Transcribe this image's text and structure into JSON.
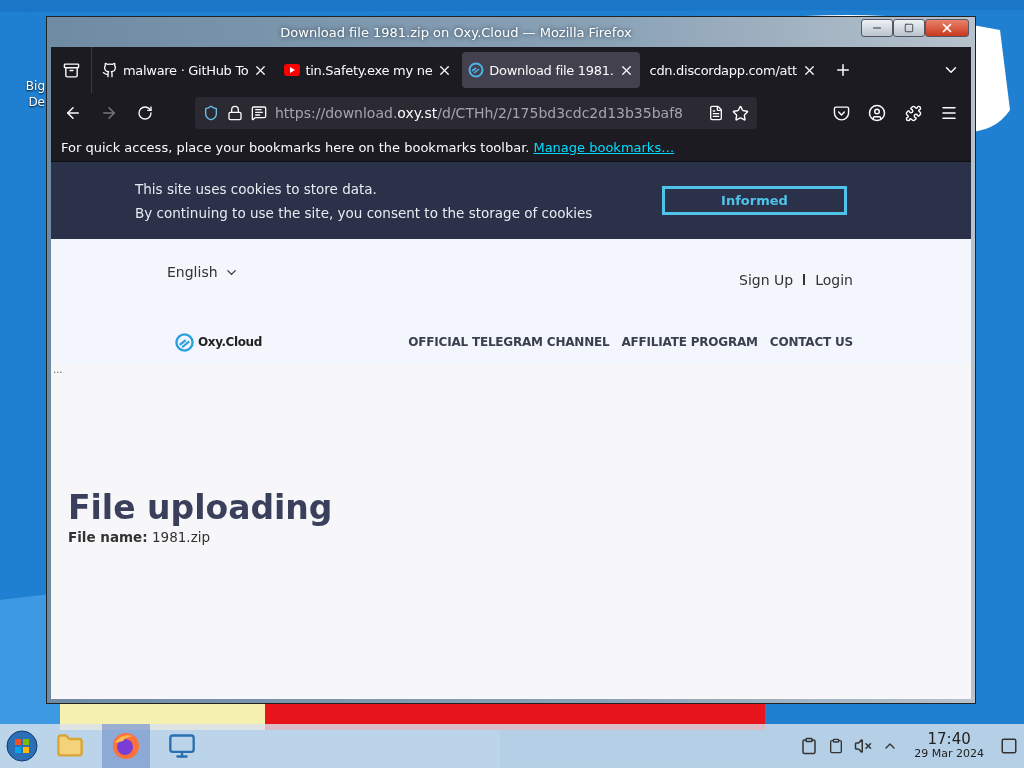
{
  "desktop": {
    "icons": [
      {
        "label_lines": [
          "Big",
          "De"
        ]
      }
    ]
  },
  "window": {
    "title": "Download file 1981.zip on Oxy.Cloud — Mozilla Firefox"
  },
  "tabs": [
    {
      "label": "malware · GitHub To",
      "kind": "github",
      "selected": false
    },
    {
      "label": "tin.Safety.exe my ne",
      "kind": "youtube",
      "selected": false
    },
    {
      "label": "Download file 1981.",
      "kind": "oxy",
      "selected": true
    },
    {
      "label": "cdn.discordapp.com/att",
      "kind": "plain",
      "selected": false
    }
  ],
  "url": {
    "prefix": "https://download.",
    "domain": "oxy.st",
    "path": "/d/CTHh/2/175bd3cdc2d13b35baf8"
  },
  "bookmarks_bar": {
    "message": "For quick access, place your bookmarks here on the bookmarks toolbar.",
    "link": "Manage bookmarks…"
  },
  "cookie_banner": {
    "lines": [
      "This site uses cookies to store data.",
      "By continuing to use the site, you consent to the storage of cookies"
    ],
    "button": "Informed"
  },
  "site_header": {
    "language": "English",
    "auth": [
      "Sign Up",
      "Login"
    ],
    "logo": "Oxy.Cloud",
    "nav": [
      "OFFICIAL TELEGRAM CHANNEL",
      "AFFILIATE PROGRAM",
      "CONTACT US"
    ]
  },
  "ellipsis": "...",
  "main": {
    "heading": "File uploading",
    "file_label": "File name:",
    "file_name": "1981.zip"
  },
  "taskbar": {
    "apps": [
      {
        "kind": "files",
        "selected": false
      },
      {
        "kind": "firefox",
        "selected": true
      },
      {
        "kind": "monitor",
        "selected": false
      }
    ],
    "time": "17:40",
    "date": "29 Mar 2024"
  }
}
